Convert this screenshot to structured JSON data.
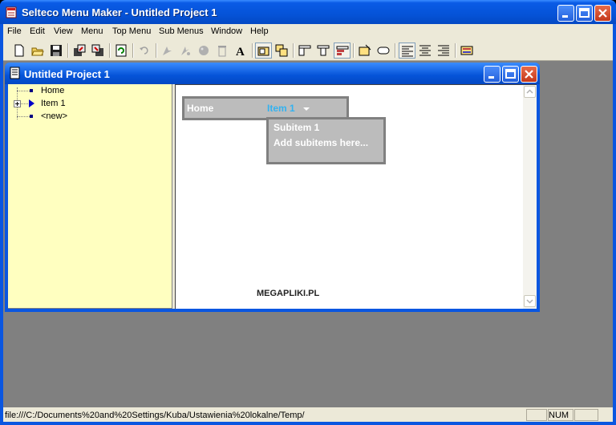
{
  "window": {
    "title": "Selteco Menu Maker - Untitled Project 1"
  },
  "menubar": [
    "File",
    "Edit",
    "View",
    "Menu",
    "Top Menu",
    "Sub Menus",
    "Window",
    "Help"
  ],
  "toolbar": {
    "buttons": [
      "new-icon",
      "open-icon",
      "save-icon",
      "import-icon",
      "export-icon",
      "refresh-icon",
      "undo-icon",
      "insert-item-icon",
      "insert-subitem-icon",
      "paint-icon",
      "delete-icon",
      "font-icon",
      "top-menu-icon",
      "sub-menu-icon",
      "align-menu-left-icon",
      "align-menu-center-icon",
      "align-menu-top-icon",
      "button-style-icon",
      "button-shape-icon",
      "align-left-icon",
      "align-center-icon",
      "align-right-icon",
      "properties-icon"
    ]
  },
  "child": {
    "title": "Untitled Project 1"
  },
  "tree": {
    "items": [
      "Home",
      "Item 1",
      "<new>"
    ]
  },
  "preview": {
    "menu_items": [
      "Home",
      "Item 1"
    ],
    "submenu_items": [
      "Subitem 1",
      "Add subitems here..."
    ],
    "watermark": "MEGAPLIKI.PL"
  },
  "colors": {
    "menu_bg": "#bcbcbc",
    "menu_active": "#33b2f0",
    "tree_bg": "#ffffc0",
    "titlebar": "#0553d8"
  },
  "statusbar": {
    "path": "file:///C:/Documents%20and%20Settings/Kuba/Ustawienia%20lokalne/Temp/",
    "num": "NUM"
  }
}
